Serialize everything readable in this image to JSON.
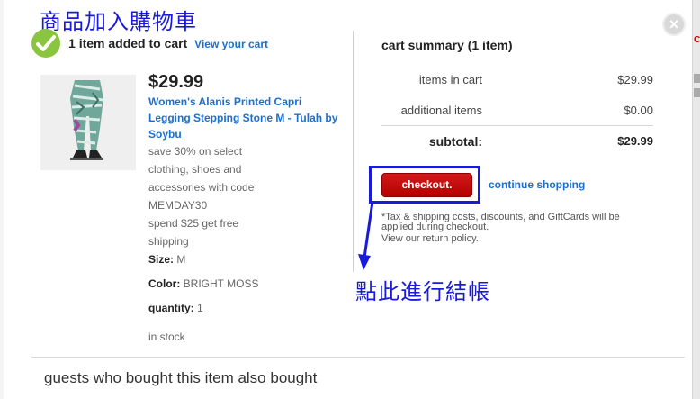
{
  "annotations": {
    "title": "商品加入購物車",
    "click_here": "點此進行結帳"
  },
  "header": {
    "count": "1",
    "added_text": "item added to cart",
    "view_cart_link": "View your cart"
  },
  "product": {
    "price": "$29.99",
    "name": "Women's Alanis Printed Capri Legging Stepping Stone M - Tulah by Soybu",
    "promo_lines": [
      "save 30% on select",
      "clothing, shoes and",
      "accessories with code",
      "MEMDAY30",
      "spend $25 get free",
      "shipping"
    ],
    "size_label": "Size:",
    "size_value": "M",
    "color_label": "Color:",
    "color_value": "BRIGHT MOSS",
    "quantity_label": "quantity:",
    "quantity_value": "1",
    "stock": "in stock"
  },
  "summary": {
    "title": "cart summary (1 item)",
    "items_label": "items in cart",
    "items_value": "$29.99",
    "additional_label": "additional items",
    "additional_value": "$0.00",
    "subtotal_label": "subtotal:",
    "subtotal_value": "$29.99"
  },
  "actions": {
    "checkout_label": "checkout.",
    "continue_label": "continue shopping"
  },
  "notes": {
    "tax": "*Tax & shipping costs, discounts, and GiftCards will be applied during checkout.",
    "return_policy": "View our return policy."
  },
  "recommendations": {
    "heading": "guests who bought this item also bought"
  },
  "close_symbol": "×",
  "colors": {
    "accent_link": "#1a6fd1",
    "checkout_red": "#cc0000",
    "annotation_blue": "#1a1adb",
    "check_green": "#8bc53f"
  },
  "icons": [
    "check-circle-icon",
    "close-icon",
    "annotation-arrow-icon"
  ]
}
